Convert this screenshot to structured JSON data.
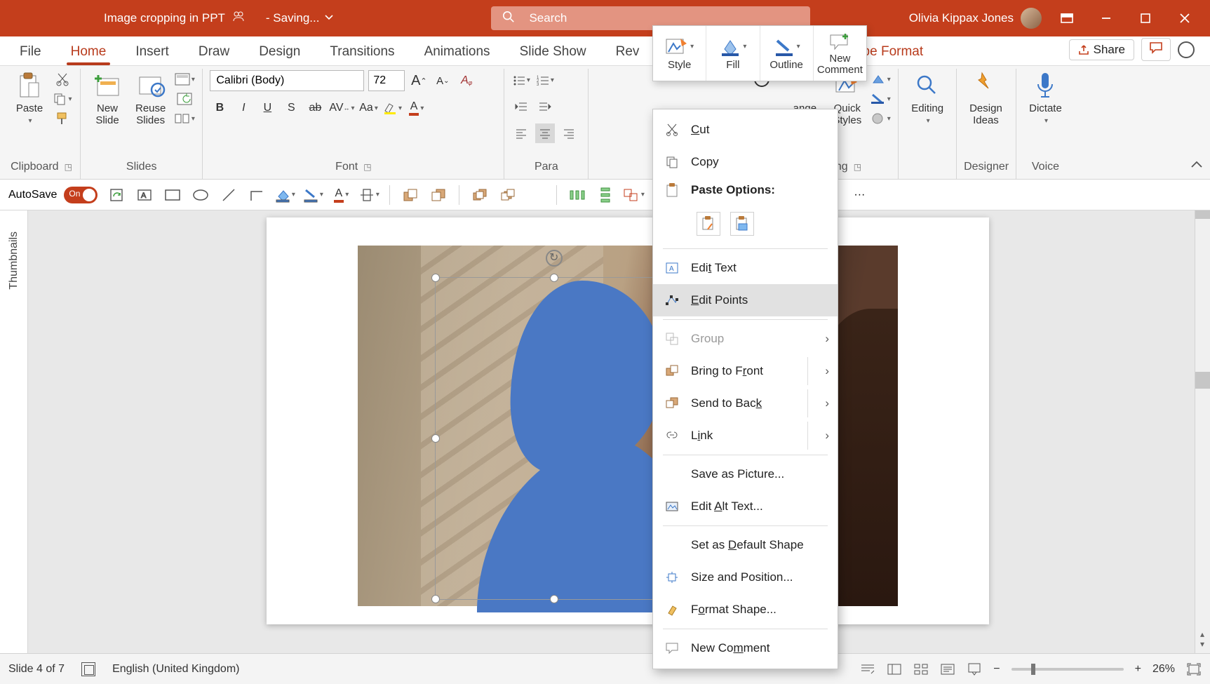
{
  "titlebar": {
    "doc_title": "Image cropping in PPT",
    "saving": "- Saving...",
    "search_placeholder": "Search",
    "user_name": "Olivia Kippax Jones"
  },
  "tabs": {
    "file": "File",
    "home": "Home",
    "insert": "Insert",
    "draw": "Draw",
    "design": "Design",
    "transitions": "Transitions",
    "animations": "Animations",
    "slideshow": "Slide Show",
    "review": "Rev",
    "shapeformat": "hape Format",
    "share": "Share"
  },
  "ribbon": {
    "clipboard": {
      "label": "Clipboard",
      "paste": "Paste"
    },
    "slides": {
      "label": "Slides",
      "newslide": "New\nSlide",
      "reuse": "Reuse\nSlides"
    },
    "font": {
      "label": "Font",
      "name": "Calibri (Body)",
      "size": "72"
    },
    "paragraph": {
      "label": "Para"
    },
    "drawing": {
      "label": "rawing",
      "arrange": "ange",
      "quick": "Quick\nStyles"
    },
    "editing": {
      "label": "Editing"
    },
    "designer": {
      "label": "Designer",
      "ideas": "Design\nIdeas"
    },
    "voice": {
      "label": "Voice",
      "dictate": "Dictate"
    }
  },
  "qat": {
    "autosave": "AutoSave",
    "on": "On"
  },
  "minitoolbar": {
    "style": "Style",
    "fill": "Fill",
    "outline": "Outline",
    "newcomment": "New\nComment"
  },
  "context": {
    "cut": "Cut",
    "copy": "Copy",
    "paste_header": "Paste Options:",
    "edit_text": "Edit Text",
    "edit_points": "Edit Points",
    "group": "Group",
    "bring_front": "Bring to Front",
    "send_back": "Send to Back",
    "link": "Link",
    "save_pic": "Save as Picture...",
    "alt_text": "Edit Alt Text...",
    "default_shape": "Set as Default Shape",
    "size_pos": "Size and Position...",
    "format_shape": "Format Shape...",
    "new_comment": "New Comment"
  },
  "thumbnails": {
    "label": "Thumbnails"
  },
  "status": {
    "slide": "Slide 4 of 7",
    "lang": "English (United Kingdom)",
    "zoom": "26%"
  }
}
